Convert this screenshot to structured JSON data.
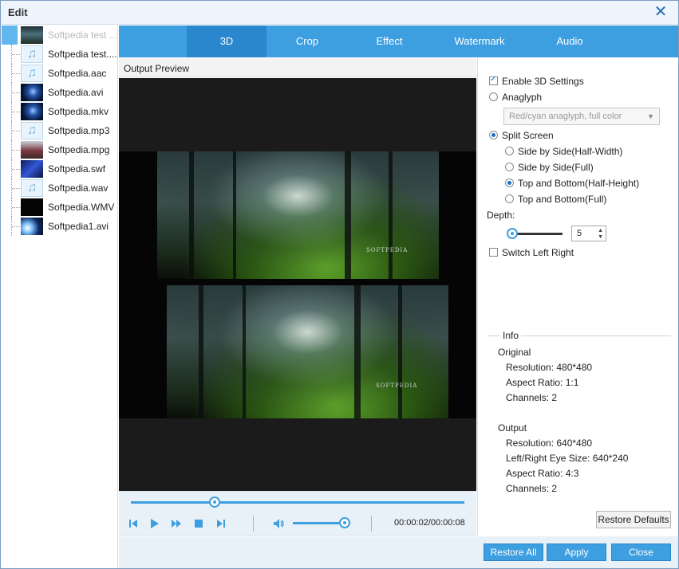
{
  "window": {
    "title": "Edit"
  },
  "files": [
    {
      "name": "Softpedia test ...",
      "kind": "video-forest",
      "selected": true
    },
    {
      "name": "Softpedia test....",
      "kind": "audio"
    },
    {
      "name": "Softpedia.aac",
      "kind": "audio"
    },
    {
      "name": "Softpedia.avi",
      "kind": "video-dark"
    },
    {
      "name": "Softpedia.mkv",
      "kind": "video-dark"
    },
    {
      "name": "Softpedia.mp3",
      "kind": "audio"
    },
    {
      "name": "Softpedia.mpg",
      "kind": "video-city"
    },
    {
      "name": "Softpedia.swf",
      "kind": "video-blue"
    },
    {
      "name": "Softpedia.wav",
      "kind": "audio"
    },
    {
      "name": "Softpedia.WMV",
      "kind": "video-black"
    },
    {
      "name": "Softpedia1.avi",
      "kind": "video-flare"
    }
  ],
  "tabs": [
    "3D",
    "Crop",
    "Effect",
    "Watermark",
    "Audio"
  ],
  "active_tab": "3D",
  "preview": {
    "label": "Output Preview",
    "logo_text": "SOFTPEDIA",
    "time": "00:00:02/00:00:08",
    "seek_position": 0.25,
    "volume": 0.9
  },
  "settings": {
    "enable_3d": {
      "label": "Enable 3D Settings",
      "checked": true
    },
    "anaglyph": {
      "label": "Anaglyph",
      "checked": false
    },
    "anaglyph_select": "Red/cyan anaglyph, full color",
    "split_screen": {
      "label": "Split Screen",
      "checked": true
    },
    "split_options": [
      {
        "label": "Side by Side(Half-Width)",
        "checked": false
      },
      {
        "label": "Side by Side(Full)",
        "checked": false
      },
      {
        "label": "Top and Bottom(Half-Height)",
        "checked": true
      },
      {
        "label": "Top and Bottom(Full)",
        "checked": false
      }
    ],
    "depth_label": "Depth:",
    "depth_value": "5",
    "switch_left_right": {
      "label": "Switch Left Right",
      "checked": false
    }
  },
  "info": {
    "title": "Info",
    "original_title": "Original",
    "original": [
      "Resolution: 480*480",
      "Aspect Ratio: 1:1",
      "Channels: 2"
    ],
    "output_title": "Output",
    "output": [
      "Resolution: 640*480",
      "Left/Right Eye Size: 640*240",
      "Aspect Ratio: 4:3",
      "Channels: 2"
    ]
  },
  "buttons": {
    "restore_defaults": "Restore Defaults",
    "restore_all": "Restore All",
    "apply": "Apply",
    "close": "Close"
  },
  "colors": {
    "accent": "#3d9ee0",
    "accent_dark": "#2a86cd"
  }
}
